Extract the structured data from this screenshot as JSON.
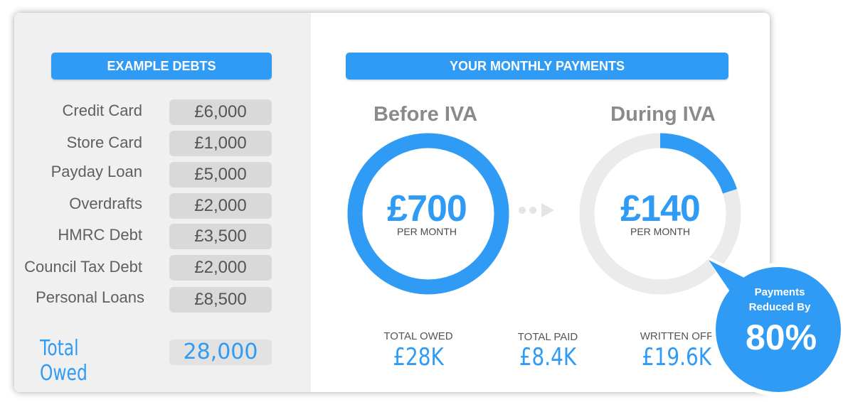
{
  "debts": {
    "header": "EXAMPLE DEBTS",
    "items": [
      {
        "label": "Credit Card",
        "value": "£6,000"
      },
      {
        "label": "Store Card",
        "value": "£1,000"
      },
      {
        "label": "Payday Loan",
        "value": "£5,000"
      },
      {
        "label": "Overdrafts",
        "value": "£2,000"
      },
      {
        "label": "HMRC Debt",
        "value": "£3,500"
      },
      {
        "label": "Council Tax Debt",
        "value": "£2,000"
      },
      {
        "label": "Personal Loans",
        "value": "£8,500"
      }
    ],
    "total_label": "Total Owed",
    "total_value": "28,000"
  },
  "payments": {
    "header": "YOUR MONTHLY PAYMENTS",
    "before": {
      "title": "Before IVA",
      "amount": "£700",
      "per": "PER MONTH",
      "fill_fraction": 1.0
    },
    "during": {
      "title": "During IVA",
      "amount": "£140",
      "per": "PER MONTH",
      "fill_fraction": 0.2
    },
    "stats": [
      {
        "label": "TOTAL OWED",
        "value": "£28K"
      },
      {
        "label": "TOTAL PAID",
        "value": "£8.4K"
      },
      {
        "label": "WRITTEN OFF",
        "value": "£19.6K"
      }
    ],
    "badge": {
      "line1": "Payments",
      "line2": "Reduced By",
      "percent": "80%"
    }
  },
  "colors": {
    "accent": "#2f9bf4",
    "ring_track": "#ebebeb",
    "left_bg": "#f0f0f1",
    "value_box": "#d9d9da",
    "label_gray": "#5f5f5f"
  },
  "icons": {
    "transition": "dots-arrow-right-icon"
  }
}
